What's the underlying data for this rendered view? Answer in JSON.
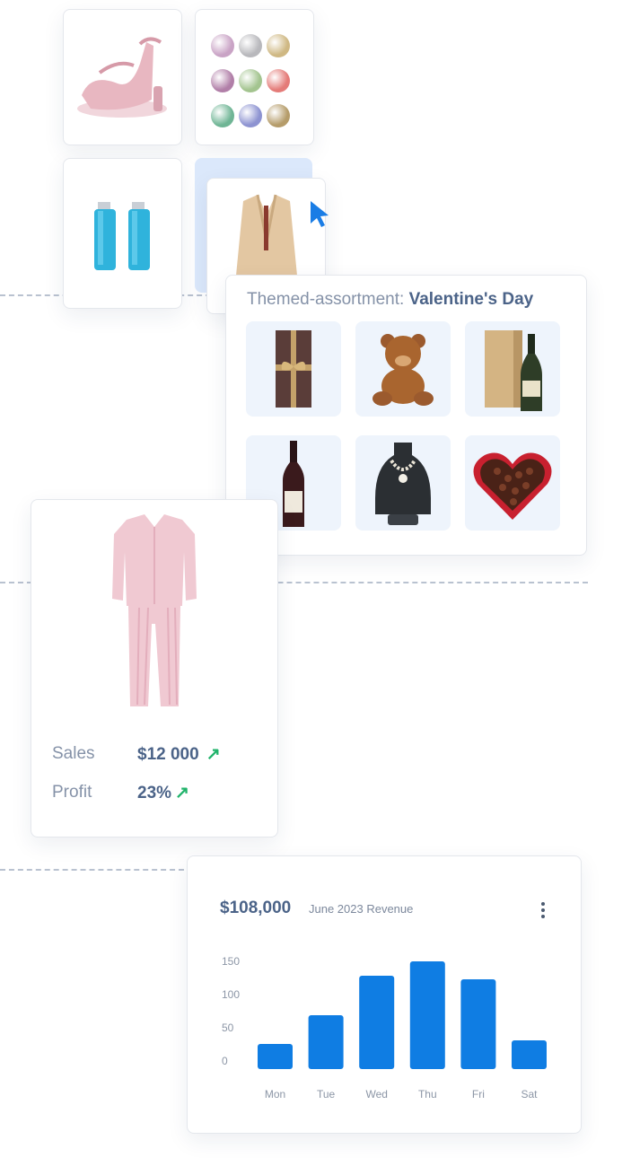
{
  "product_grid": {
    "selected_tile_color": "#dbe8fb",
    "cursor_color": "#1a7de5",
    "swatch_colors": [
      "#c9a3c5",
      "#b8b8bc",
      "#cfb883",
      "#b17fa8",
      "#a3c48f",
      "#e47b78",
      "#6fb595",
      "#8d93d1",
      "#b59c6a"
    ]
  },
  "assortment": {
    "title_prefix": "Themed-assortment:",
    "title_theme": "Valentine's Day",
    "items": [
      "chocolate-gift-box",
      "teddy-bear",
      "champagne-with-box",
      "red-wine-bottle",
      "pearl-necklace-on-stand",
      "heart-chocolate-box"
    ]
  },
  "product_card": {
    "sales_label": "Sales",
    "sales_value": "$12 000",
    "profit_label": "Profit",
    "profit_value": "23%",
    "trend_icon": "arrow-up-right-icon",
    "trend_color": "#21b36b"
  },
  "revenue_card": {
    "amount": "$108,000",
    "subtitle": "June 2023 Revenue",
    "menu_icon": "more-vertical-icon"
  },
  "chart_data": {
    "type": "bar",
    "categories": [
      "Mon",
      "Tue",
      "Wed",
      "Thu",
      "Fri",
      "Sat"
    ],
    "values": [
      35,
      75,
      130,
      150,
      125,
      40
    ],
    "ylim": [
      0,
      150
    ],
    "yticks": [
      "150",
      "100",
      "50",
      "0"
    ],
    "bar_color": "#0f7de3",
    "grid": false
  }
}
